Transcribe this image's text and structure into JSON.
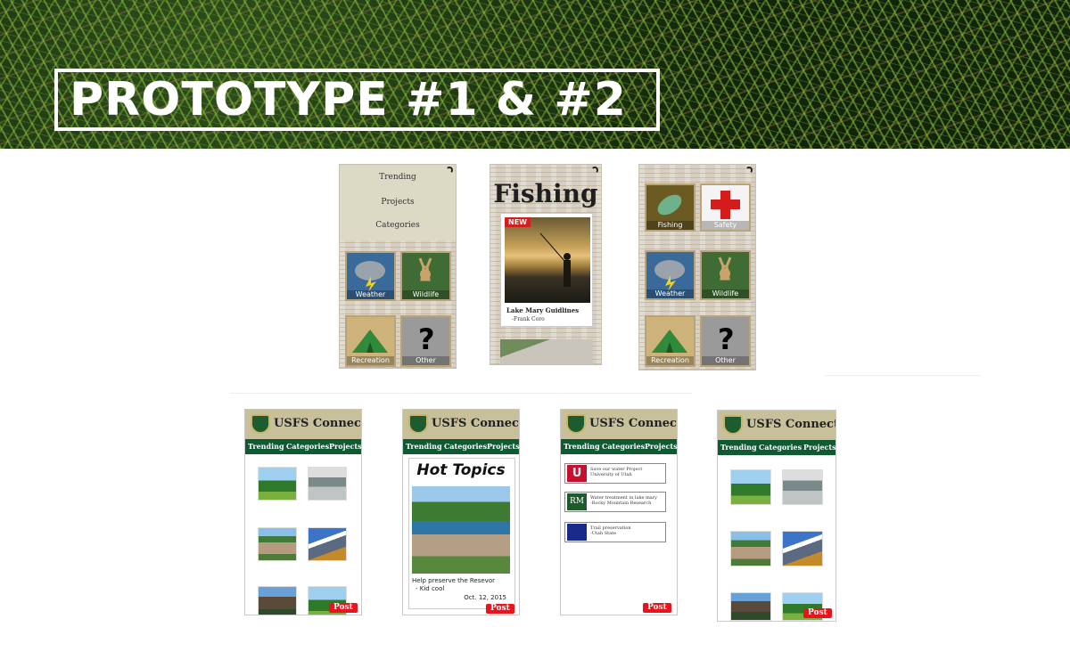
{
  "banner": {
    "title": "PROTOTYPE #1 & #2"
  },
  "prototype1": {
    "menu": [
      "Trending",
      "Projects",
      "Categories"
    ],
    "tiles": {
      "weather": "Weather",
      "wildlife": "Wildlife",
      "recreation": "Recreation",
      "other": "Other",
      "fishing": "Fishing",
      "safety": "Safety"
    },
    "fishing_screen": {
      "title": "Fishing",
      "badge": "NEW",
      "caption": "Lake Mary Guidlines",
      "author": "-Frank Coro"
    }
  },
  "prototype2": {
    "app_title": "USFS Connect",
    "nav": [
      "Trending",
      "Categories",
      "Projects"
    ],
    "post_label": "Post",
    "hot_topics": {
      "title": "Hot Topics",
      "caption": "Help preserve the Resevor",
      "author": "- Kid cool",
      "date": "Oct. 12, 2015"
    },
    "projects": [
      {
        "logo": "U",
        "line1": "Save our water Project",
        "line2": "University of Utah"
      },
      {
        "logo": "RM",
        "line1": "Water treatment in lake mary",
        "line2": "-Rocky Mountain Research"
      },
      {
        "logo": "",
        "line1": "Trail preservation",
        "line2": "-Utah State"
      }
    ]
  }
}
